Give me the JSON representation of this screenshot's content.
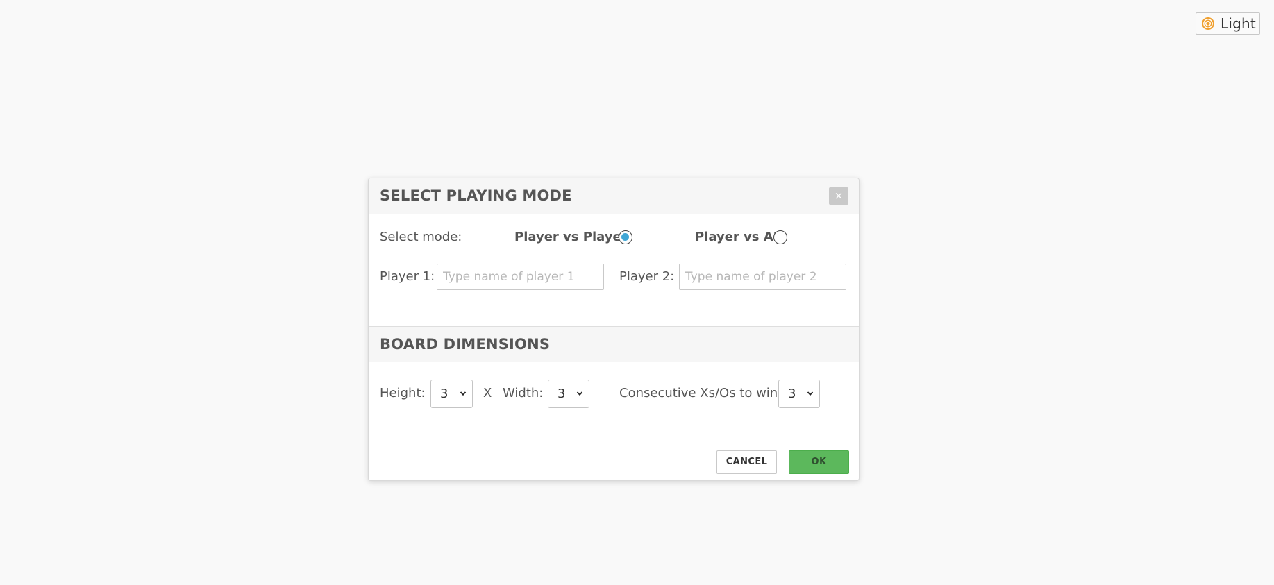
{
  "theme_toggle": {
    "label": "Light",
    "icon": "sun-icon"
  },
  "dialog": {
    "title": "SELECT PLAYING MODE",
    "close_label": "×",
    "mode": {
      "label": "Select mode:",
      "options": [
        {
          "label": "Player vs Player",
          "checked": true
        },
        {
          "label": "Player vs AI",
          "checked": false
        }
      ]
    },
    "players": {
      "player1_label": "Player 1:",
      "player1_value": "",
      "player1_placeholder": "Type name of player 1",
      "player2_label": "Player 2:",
      "player2_value": "",
      "player2_placeholder": "Type name of player 2"
    },
    "board": {
      "title": "BOARD DIMENSIONS",
      "height_label": "Height:",
      "height_value": "3",
      "times_label": "X",
      "width_label": "Width:",
      "width_value": "3",
      "win_label": "Consecutive Xs/Os to win:",
      "win_value": "3"
    },
    "buttons": {
      "cancel": "CANCEL",
      "ok": "OK"
    }
  },
  "colors": {
    "background": "#f9f9f9",
    "ok_button": "#5cb85c",
    "radio_selected": "#3fa6d5",
    "sun_icon": "#f0a030"
  }
}
